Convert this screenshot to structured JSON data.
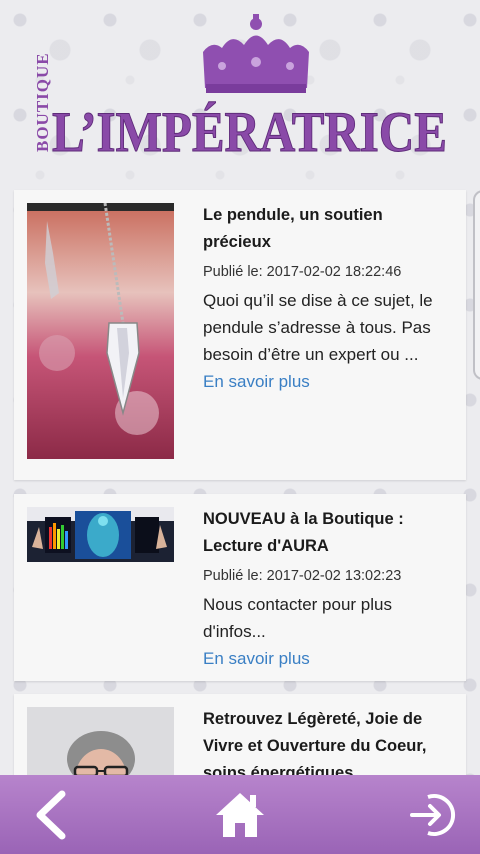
{
  "brand": {
    "side_text": "BOUTIQUE",
    "name": "L’IMPÉRATRICE",
    "accent": "#8a4aa8",
    "accent_light": "#b586cf"
  },
  "posts": [
    {
      "title_line1": "Le pendule, un soutien",
      "title_line2": "précieux",
      "date": "Publié le: 2017-02-02 18:22:46",
      "excerpt_line1": "Quoi qu’il se dise à ce sujet, le",
      "excerpt_line2": "pendule s’adresse à tous. Pas",
      "excerpt_line3": "besoin d’être un expert ou ...",
      "more": "En savoir plus",
      "thumb": "pendulum-photo"
    },
    {
      "title_line1": "NOUVEAU à la Boutique :",
      "title_line2": "Lecture d'AURA",
      "date": "Publié le: 2017-02-02 13:02:23",
      "excerpt_line1": "Nous contacter pour plus",
      "excerpt_line2": "d'infos...",
      "more": "En savoir plus",
      "thumb": "aura-scan-photo"
    },
    {
      "title_line1": "Retrouvez Légèreté, Joie de",
      "title_line2": "Vivre et Ouverture du Coeur,",
      "title_line3": "soins énergétiques",
      "thumb": "woman-portrait-photo"
    }
  ],
  "nav": {
    "back_icon": "chevron-left-icon",
    "home_icon": "home-icon",
    "login_icon": "sign-in-icon",
    "color": "#a872c2"
  }
}
